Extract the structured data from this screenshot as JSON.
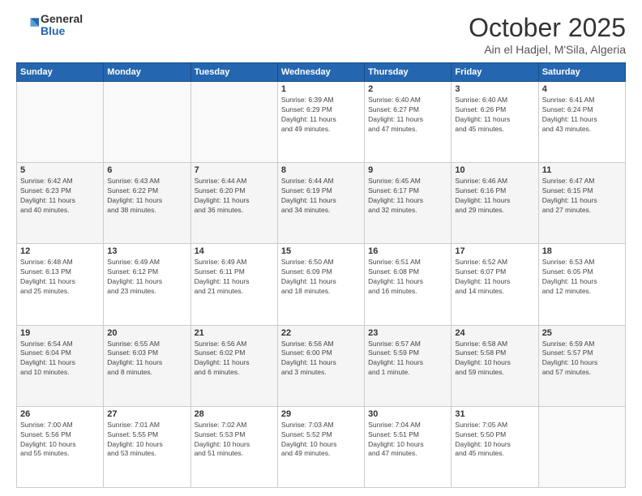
{
  "logo": {
    "general": "General",
    "blue": "Blue"
  },
  "header": {
    "month": "October 2025",
    "location": "Ain el Hadjel, M'Sila, Algeria"
  },
  "days_of_week": [
    "Sunday",
    "Monday",
    "Tuesday",
    "Wednesday",
    "Thursday",
    "Friday",
    "Saturday"
  ],
  "weeks": [
    [
      {
        "num": "",
        "info": ""
      },
      {
        "num": "",
        "info": ""
      },
      {
        "num": "",
        "info": ""
      },
      {
        "num": "1",
        "info": "Sunrise: 6:39 AM\nSunset: 6:29 PM\nDaylight: 11 hours\nand 49 minutes."
      },
      {
        "num": "2",
        "info": "Sunrise: 6:40 AM\nSunset: 6:27 PM\nDaylight: 11 hours\nand 47 minutes."
      },
      {
        "num": "3",
        "info": "Sunrise: 6:40 AM\nSunset: 6:26 PM\nDaylight: 11 hours\nand 45 minutes."
      },
      {
        "num": "4",
        "info": "Sunrise: 6:41 AM\nSunset: 6:24 PM\nDaylight: 11 hours\nand 43 minutes."
      }
    ],
    [
      {
        "num": "5",
        "info": "Sunrise: 6:42 AM\nSunset: 6:23 PM\nDaylight: 11 hours\nand 40 minutes."
      },
      {
        "num": "6",
        "info": "Sunrise: 6:43 AM\nSunset: 6:22 PM\nDaylight: 11 hours\nand 38 minutes."
      },
      {
        "num": "7",
        "info": "Sunrise: 6:44 AM\nSunset: 6:20 PM\nDaylight: 11 hours\nand 36 minutes."
      },
      {
        "num": "8",
        "info": "Sunrise: 6:44 AM\nSunset: 6:19 PM\nDaylight: 11 hours\nand 34 minutes."
      },
      {
        "num": "9",
        "info": "Sunrise: 6:45 AM\nSunset: 6:17 PM\nDaylight: 11 hours\nand 32 minutes."
      },
      {
        "num": "10",
        "info": "Sunrise: 6:46 AM\nSunset: 6:16 PM\nDaylight: 11 hours\nand 29 minutes."
      },
      {
        "num": "11",
        "info": "Sunrise: 6:47 AM\nSunset: 6:15 PM\nDaylight: 11 hours\nand 27 minutes."
      }
    ],
    [
      {
        "num": "12",
        "info": "Sunrise: 6:48 AM\nSunset: 6:13 PM\nDaylight: 11 hours\nand 25 minutes."
      },
      {
        "num": "13",
        "info": "Sunrise: 6:49 AM\nSunset: 6:12 PM\nDaylight: 11 hours\nand 23 minutes."
      },
      {
        "num": "14",
        "info": "Sunrise: 6:49 AM\nSunset: 6:11 PM\nDaylight: 11 hours\nand 21 minutes."
      },
      {
        "num": "15",
        "info": "Sunrise: 6:50 AM\nSunset: 6:09 PM\nDaylight: 11 hours\nand 18 minutes."
      },
      {
        "num": "16",
        "info": "Sunrise: 6:51 AM\nSunset: 6:08 PM\nDaylight: 11 hours\nand 16 minutes."
      },
      {
        "num": "17",
        "info": "Sunrise: 6:52 AM\nSunset: 6:07 PM\nDaylight: 11 hours\nand 14 minutes."
      },
      {
        "num": "18",
        "info": "Sunrise: 6:53 AM\nSunset: 6:05 PM\nDaylight: 11 hours\nand 12 minutes."
      }
    ],
    [
      {
        "num": "19",
        "info": "Sunrise: 6:54 AM\nSunset: 6:04 PM\nDaylight: 11 hours\nand 10 minutes."
      },
      {
        "num": "20",
        "info": "Sunrise: 6:55 AM\nSunset: 6:03 PM\nDaylight: 11 hours\nand 8 minutes."
      },
      {
        "num": "21",
        "info": "Sunrise: 6:56 AM\nSunset: 6:02 PM\nDaylight: 11 hours\nand 6 minutes."
      },
      {
        "num": "22",
        "info": "Sunrise: 6:56 AM\nSunset: 6:00 PM\nDaylight: 11 hours\nand 3 minutes."
      },
      {
        "num": "23",
        "info": "Sunrise: 6:57 AM\nSunset: 5:59 PM\nDaylight: 11 hours\nand 1 minute."
      },
      {
        "num": "24",
        "info": "Sunrise: 6:58 AM\nSunset: 5:58 PM\nDaylight: 10 hours\nand 59 minutes."
      },
      {
        "num": "25",
        "info": "Sunrise: 6:59 AM\nSunset: 5:57 PM\nDaylight: 10 hours\nand 57 minutes."
      }
    ],
    [
      {
        "num": "26",
        "info": "Sunrise: 7:00 AM\nSunset: 5:56 PM\nDaylight: 10 hours\nand 55 minutes."
      },
      {
        "num": "27",
        "info": "Sunrise: 7:01 AM\nSunset: 5:55 PM\nDaylight: 10 hours\nand 53 minutes."
      },
      {
        "num": "28",
        "info": "Sunrise: 7:02 AM\nSunset: 5:53 PM\nDaylight: 10 hours\nand 51 minutes."
      },
      {
        "num": "29",
        "info": "Sunrise: 7:03 AM\nSunset: 5:52 PM\nDaylight: 10 hours\nand 49 minutes."
      },
      {
        "num": "30",
        "info": "Sunrise: 7:04 AM\nSunset: 5:51 PM\nDaylight: 10 hours\nand 47 minutes."
      },
      {
        "num": "31",
        "info": "Sunrise: 7:05 AM\nSunset: 5:50 PM\nDaylight: 10 hours\nand 45 minutes."
      },
      {
        "num": "",
        "info": ""
      }
    ]
  ]
}
